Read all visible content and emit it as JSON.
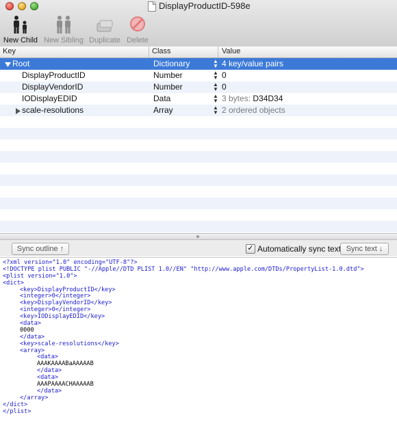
{
  "window": {
    "title": "DisplayProductID-598e"
  },
  "toolbar": {
    "new_child": "New Child",
    "new_sibling": "New Sibling",
    "duplicate": "Duplicate",
    "delete": "Delete"
  },
  "columns": {
    "key": "Key",
    "class": "Class",
    "value": "Value"
  },
  "rows": [
    {
      "key": "Root",
      "class": "Dictionary",
      "value": "4 key/value pairs",
      "selected": true
    },
    {
      "key": "DisplayProductID",
      "class": "Number",
      "value": "0"
    },
    {
      "key": "DisplayVendorID",
      "class": "Number",
      "value": "0"
    },
    {
      "key": "IODisplayEDID",
      "class": "Data",
      "value_prefix": "3 bytes:",
      "value": "D34D34"
    },
    {
      "key": "scale-resolutions",
      "class": "Array",
      "value": "2 ordered objects"
    }
  ],
  "sync": {
    "outline_button": "Sync outline ↑",
    "auto_label": "Automatically sync text",
    "auto_checked": true,
    "text_button": "Sync text ↓"
  },
  "xml": {
    "l1": "<?xml version=\"1.0\" encoding=\"UTF-8\"?>",
    "l2": "<!DOCTYPE plist PUBLIC \"-//Apple//DTD PLIST 1.0//EN\" \"http://www.apple.com/DTDs/PropertyList-1.0.dtd\">",
    "l3": "<plist version=\"1.0\">",
    "l4": "<dict>",
    "l5": "<key>DisplayProductID</key>",
    "l6": "<integer>0</integer>",
    "l7": "<key>DisplayVendorID</key>",
    "l8": "<integer>0</integer>",
    "l9": "<key>IODisplayEDID</key>",
    "l10": "<data>",
    "l11": "0000",
    "l12": "</data>",
    "l13": "<key>scale-resolutions</key>",
    "l14": "<array>",
    "l15": "<data>",
    "l16": "AAAKAAAABaAAAAAB",
    "l17": "</data>",
    "l18": "<data>",
    "l19": "AAAPAAAACHAAAAAB",
    "l20": "</data>",
    "l21": "</array>",
    "l22": "</dict>",
    "l23": "</plist>"
  }
}
